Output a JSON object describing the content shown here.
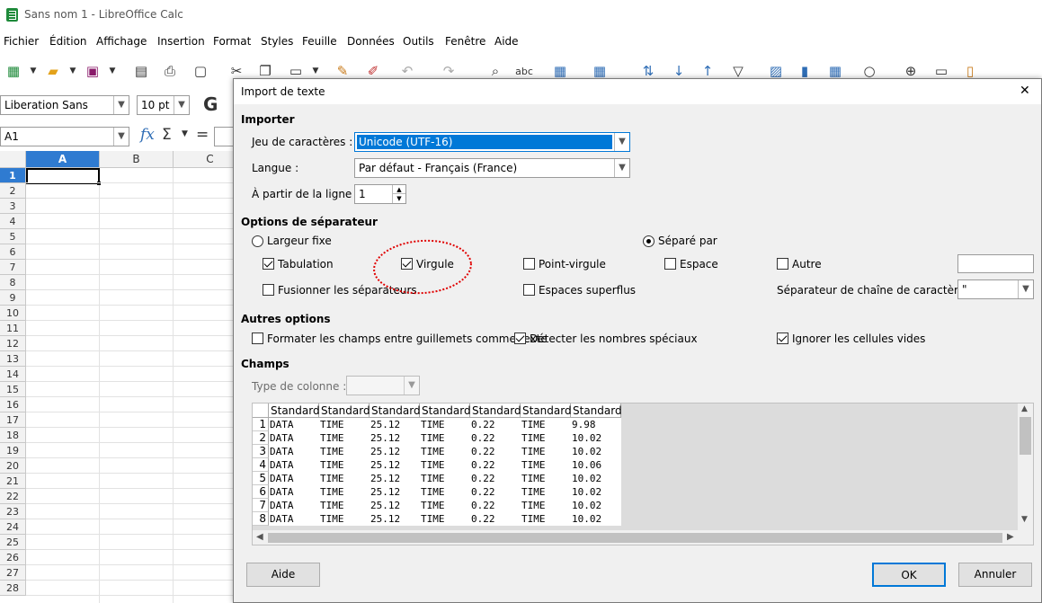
{
  "window": {
    "title": "Sans nom 1 - LibreOffice Calc"
  },
  "menubar": {
    "items": [
      "Fichier",
      "Édition",
      "Affichage",
      "Insertion",
      "Format",
      "Styles",
      "Feuille",
      "Données",
      "Outils",
      "Fenêtre",
      "Aide"
    ]
  },
  "toolbar2": {
    "font_name": "Liberation Sans",
    "font_size": "10 pt",
    "bold_label": "G"
  },
  "formulabar": {
    "cell_ref": "A1",
    "fx_label": "fx",
    "sum_label": "Σ",
    "equals_label": "="
  },
  "sheet": {
    "columns": [
      "A",
      "B",
      "C"
    ],
    "rows": [
      "1",
      "2",
      "3",
      "4",
      "5",
      "6",
      "7",
      "8",
      "9",
      "10",
      "11",
      "12",
      "13",
      "14",
      "15",
      "16",
      "17",
      "18",
      "19",
      "20",
      "21",
      "22",
      "23",
      "24",
      "25",
      "26",
      "27",
      "28"
    ]
  },
  "dialog": {
    "title": "Import de texte",
    "close_glyph": "✕",
    "import_section": "Importer",
    "charset_label": "Jeu de caractères :",
    "charset_value": "Unicode (UTF-16)",
    "language_label": "Langue :",
    "language_value": "Par défaut - Français (France)",
    "from_line_label": "À partir de la ligne :",
    "from_line_value": "1",
    "separator_section": "Options de séparateur",
    "fixed_width_label": "Largeur fixe",
    "separated_by_label": "Séparé par",
    "tab_label": "Tabulation",
    "comma_label": "Virgule",
    "semicolon_label": "Point-virgule",
    "space_label": "Espace",
    "other_label": "Autre",
    "merge_label": "Fusionner les séparateurs",
    "trim_label": "Espaces superflus",
    "string_delim_label": "Séparateur de chaîne de caractères :",
    "string_delim_value": "\"",
    "other_options_section": "Autres options",
    "quoted_label": "Formater les champs entre guillemets comme texte",
    "detect_label": "Détecter les nombres spéciaux",
    "skip_empty_label": "Ignorer les cellules vides",
    "fields_section": "Champs",
    "column_type_label": "Type de colonne :",
    "help_button": "Aide",
    "ok_button": "OK",
    "cancel_button": "Annuler",
    "states": {
      "tab": true,
      "comma": true,
      "semicolon": false,
      "space": false,
      "other": false,
      "merge": false,
      "trim": false,
      "quoted": false,
      "detect": true,
      "skip_empty": true,
      "separated": true
    }
  },
  "preview": {
    "headers": [
      "Standard",
      "Standard",
      "Standard",
      "Standard",
      "Standard",
      "Standard",
      "Standard"
    ],
    "row_numbers": [
      "1",
      "2",
      "3",
      "4",
      "5",
      "6",
      "7",
      "8"
    ],
    "rows": [
      [
        "DATA",
        "TIME",
        "25.12",
        "TIME",
        "0.22",
        "TIME",
        "9.98"
      ],
      [
        "DATA",
        "TIME",
        "25.12",
        "TIME",
        "0.22",
        "TIME",
        "10.02"
      ],
      [
        "DATA",
        "TIME",
        "25.12",
        "TIME",
        "0.22",
        "TIME",
        "10.02"
      ],
      [
        "DATA",
        "TIME",
        "25.12",
        "TIME",
        "0.22",
        "TIME",
        "10.06"
      ],
      [
        "DATA",
        "TIME",
        "25.12",
        "TIME",
        "0.22",
        "TIME",
        "10.02"
      ],
      [
        "DATA",
        "TIME",
        "25.12",
        "TIME",
        "0.22",
        "TIME",
        "10.02"
      ],
      [
        "DATA",
        "TIME",
        "25.12",
        "TIME",
        "0.22",
        "TIME",
        "10.02"
      ],
      [
        "DATA",
        "TIME",
        "25.12",
        "TIME",
        "0.22",
        "TIME",
        "10.02"
      ]
    ]
  },
  "colors": {
    "selection": "#0078d7",
    "annotation": "#e00000",
    "active_header": "#2f7bd1"
  }
}
